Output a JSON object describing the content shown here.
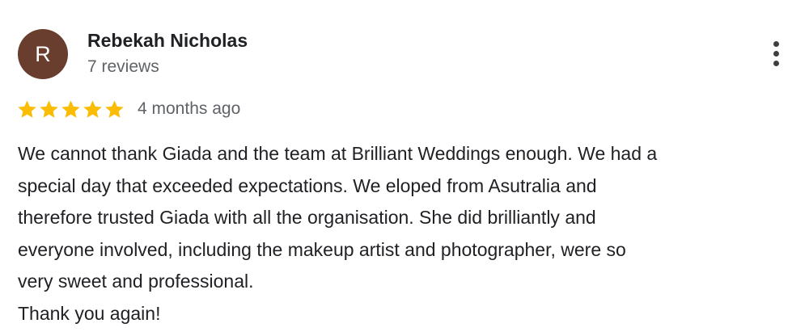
{
  "reviewer": {
    "avatar_letter": "R",
    "avatar_color": "#6a3e2f",
    "name": "Rebekah Nicholas",
    "review_count": "7 reviews"
  },
  "menu": {
    "icon": "more-vert-icon"
  },
  "rating": {
    "stars": 5,
    "max_stars": 5,
    "star_color": "#fbbc04",
    "date": "4 months ago"
  },
  "review": {
    "lines": [
      "We cannot thank Giada and the team at Brilliant Weddings enough. We had a",
      "special day that exceeded expectations. We eloped from Asutralia and",
      "therefore trusted Giada with all the organisation. She did brilliantly and",
      "everyone involved, including the makeup artist and photographer, were so",
      "very sweet and professional.",
      "Thank you again!"
    ]
  }
}
